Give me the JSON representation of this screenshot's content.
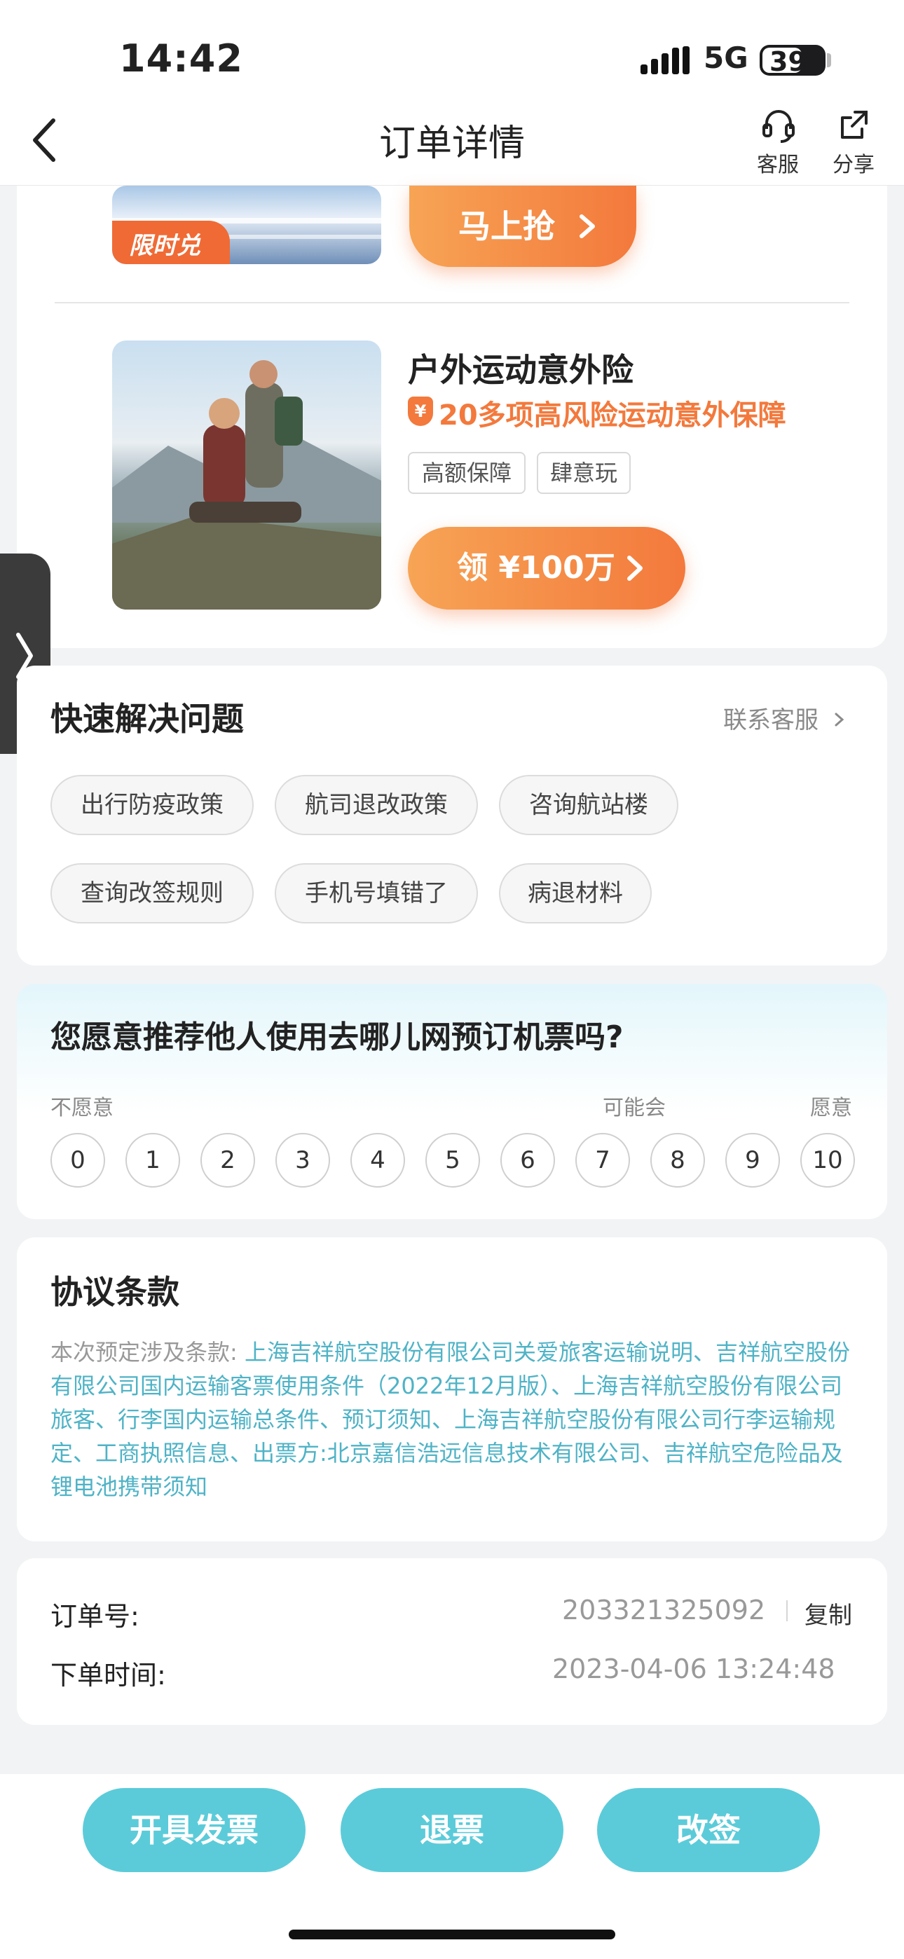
{
  "status_bar": {
    "time": "14:42",
    "network": "5G",
    "battery": "39"
  },
  "nav": {
    "title": "订单详情",
    "service_label": "客服",
    "share_label": "分享"
  },
  "promo_top": {
    "badge": "限时兑",
    "button": "马上抢"
  },
  "promo_insurance": {
    "title": "户外运动意外险",
    "subtitle": "20多项高风险运动意外保障",
    "yen_icon": "¥",
    "tags": [
      "高额保障",
      "肆意玩"
    ],
    "button": "领 ¥100万"
  },
  "quick_help": {
    "title": "快速解决问题",
    "link": "联系客服",
    "chips": [
      "出行防疫政策",
      "航司退改政策",
      "咨询航站楼",
      "查询改签规则",
      "手机号填错了",
      "病退材料"
    ]
  },
  "survey": {
    "question": "您愿意推荐他人使用去哪儿网预订机票吗?",
    "label_low": "不愿意",
    "label_mid": "可能会",
    "label_high": "愿意",
    "scores": [
      "0",
      "1",
      "2",
      "3",
      "4",
      "5",
      "6",
      "7",
      "8",
      "9",
      "10"
    ]
  },
  "terms": {
    "title": "协议条款",
    "prefix": "本次预定涉及条款:",
    "links": "上海吉祥航空股份有限公司关爱旅客运输说明、吉祥航空股份有限公司国内运输客票使用条件（2022年12月版）、上海吉祥航空股份有限公司旅客、行李国内运输总条件、预订须知、上海吉祥航空股份有限公司行李运输规定、工商执照信息、出票方:北京嘉信浩远信息技术有限公司、吉祥航空危险品及锂电池携带须知"
  },
  "order": {
    "number_label": "订单号:",
    "number": "203321325092",
    "copy": "复制",
    "time_label": "下单时间:",
    "time": "2023-04-06 13:24:48"
  },
  "actions": {
    "invoice": "开具发票",
    "refund": "退票",
    "change": "改签"
  },
  "colors": {
    "accent_teal": "#5bcbd9",
    "accent_orange": "#f3793c",
    "link_teal": "#4fb3c6"
  }
}
